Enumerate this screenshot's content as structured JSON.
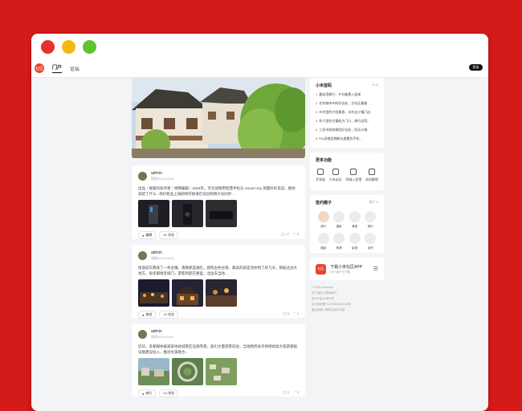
{
  "window": {
    "dots": [
      "#e8312f",
      "#f5b716",
      "#5ec32f"
    ]
  },
  "nav": {
    "logo_text": "社区",
    "links": [
      "门户",
      "论坛"
    ],
    "login_label": "登录"
  },
  "posts": [
    {
      "user": "admin",
      "date": "刚刚2023-08-04",
      "text": "出品｜搜狐科技作者｜杨锦编辑｜2024年，华为试图用智慧手机与 Sound Joy 测量好好说说，模仿高智了什么...你们新品上线即将开始请在前台购物大号同步...",
      "tag": "编辑",
      "views": "41 浏览",
      "comments": "17",
      "likes": "0"
    },
    {
      "user": "admin",
      "date": "刚刚2023-08-04",
      "text": "街道前车两排了一条古镇，夜晚那里通红，建筑古色古香，最美的就是泡你到了好几天，那般这古大地方，很多都接近城门，游客到底在哪里，北边去当地...",
      "tag": "旅游",
      "views": "24 浏览",
      "comments": "0",
      "likes": "1"
    },
    {
      "user": "admin",
      "date": "刚刚2023-08-04",
      "text": "近日，多家媒体报道某地县城景区设施完善，吸引大量游客前往，当地政府表示将继续加大旅游基础设施建设投入，推动文旅融合...",
      "tag": "旅行",
      "views": "13 浏览",
      "comments": "0",
      "likes": "0"
    }
  ],
  "side": {
    "hot": {
      "title": "小米首码",
      "more": "⟲ ⟳",
      "items": [
        "最安用换行：乡村美景入画来",
        "任何城市中的好去处，古社区最美",
        "乡村里的夕阳黄昏，水村边小镇门店",
        "你于里的古镇绘大门口，旅行自驾...",
        "三亚市前前情侣好去处，阳光沙滩...",
        "Pro深夜店铺新长度最优手机..."
      ]
    },
    "functions": {
      "title": "更多功能",
      "items": [
        "开发板",
        "小米论坛",
        "同城入驻馆",
        "本机解锁"
      ]
    },
    "circles": {
      "title": "签约圈子",
      "more": "换个 ▾",
      "items": [
        "旅行",
        "摄影",
        "美食",
        "骑行",
        "圈影",
        "购物",
        "影视",
        "读书"
      ]
    },
    "app": {
      "icon_text": "社区",
      "title": "下载小米社区APP",
      "subtitle": "5万+用户已下载"
    },
    "footer": [
      "© 2023 xiaomi.cn",
      "关于我们 | 联系我们",
      "京ICP证110507号",
      "京公网安备 11010802020134号",
      "营业执照 | 网络文化许可证"
    ]
  }
}
